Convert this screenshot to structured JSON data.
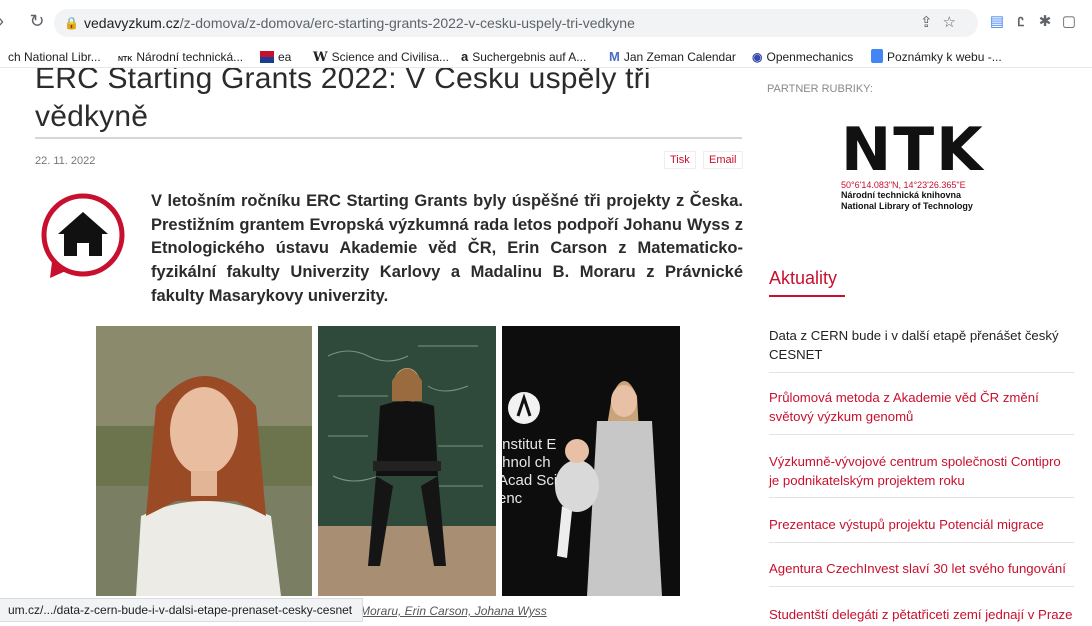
{
  "browser": {
    "url_domain": "vedavyzkum.cz",
    "url_path": "/z-domova/z-domova/erc-starting-grants-2022-v-cesku-uspely-tri-vedkyne",
    "bookmarks": [
      {
        "icon": "",
        "label": "ch National Libr..."
      },
      {
        "icon": "NTK",
        "label": "Národní technická..."
      },
      {
        "icon": "",
        "label": "ea"
      },
      {
        "icon": "W",
        "label": "Science and Civilisa..."
      },
      {
        "icon": "a",
        "label": "Suchergebnis auf A..."
      },
      {
        "icon": "M",
        "label": "Jan Zeman Calendar"
      },
      {
        "icon": "",
        "label": "Openmechanics"
      },
      {
        "icon": "",
        "label": "Poznámky k webu -..."
      }
    ],
    "status_url": "um.cz/.../data-z-cern-bude-i-v-dalsi-etape-prenaset-cesky-cesnet"
  },
  "article": {
    "title": "ERC Starting Grants 2022: V Česku uspěly tři vědkyně",
    "date": "22. 11. 2022",
    "print_label": "Tisk",
    "email_label": "Email",
    "perex": "V letošním ročníku ERC Starting Grants byly úspěšné tři projekty z Česka. Prestižním grantem Evropská výzkumná rada letos podpoří Johanu Wyss z Etnologického ústavu Akademie věd ČR, Erin Carson z Matematicko-fyzikální fakulty Univerzity Karlovy a Madalinu B. Moraru z Právnické fakulty Masarykovy univerzity.",
    "photo_sign": "Institut Ethnol ch Acad Scienc",
    "caption": "Moraru, Erin Carson, Johana Wyss"
  },
  "sidebar": {
    "partner_label": "PARTNER RUBRIKY:",
    "ntk_logo": "NTK",
    "ntk_coords": "50°6'14.083\"N, 14°23'26.365\"E",
    "ntk_name_cz": "Národní technická knihovna",
    "ntk_name_en": "National Library of Technology",
    "news_heading": "Aktuality",
    "news": [
      "Data z CERN bude i v další etapě přenášet český CESNET",
      "Průlomová metoda z Akademie věd ČR změní světový výzkum genomů",
      "Výzkumně-vývojové centrum společnosti Contipro je podnikatelským projektem roku",
      "Prezentace výstupů projektu Potenciál migrace",
      "Agentura CzechInvest slaví 30 let svého fungování",
      "Studentští delegáti z pětatřiceti zemí jednají v Praze"
    ]
  },
  "colors": {
    "accent": "#c8102e",
    "chrome": "#f1f3f4"
  }
}
